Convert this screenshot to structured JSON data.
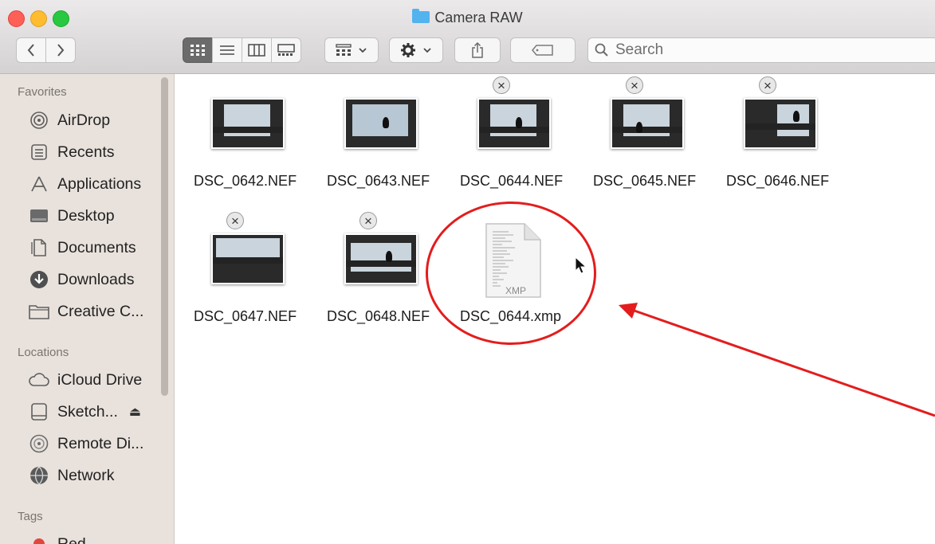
{
  "window": {
    "title": "Camera RAW"
  },
  "toolbar": {
    "back_icon": "chevron-left-icon",
    "forward_icon": "chevron-right-icon",
    "view_modes": [
      "icon-view-icon",
      "list-view-icon",
      "column-view-icon",
      "gallery-view-icon"
    ],
    "active_view": "icon-view-icon",
    "search_placeholder": "Search"
  },
  "sidebar": {
    "favorites_header": "Favorites",
    "favorites": [
      {
        "label": "AirDrop",
        "icon": "airdrop-icon"
      },
      {
        "label": "Recents",
        "icon": "recents-icon"
      },
      {
        "label": "Applications",
        "icon": "applications-icon"
      },
      {
        "label": "Desktop",
        "icon": "desktop-icon"
      },
      {
        "label": "Documents",
        "icon": "documents-icon"
      },
      {
        "label": "Downloads",
        "icon": "downloads-icon"
      },
      {
        "label": "Creative C...",
        "icon": "folder-icon"
      }
    ],
    "locations_header": "Locations",
    "locations": [
      {
        "label": "iCloud Drive",
        "icon": "cloud-icon"
      },
      {
        "label": "Sketch...",
        "icon": "drive-icon",
        "eject": "⏏"
      },
      {
        "label": "Remote Di...",
        "icon": "disc-icon"
      },
      {
        "label": "Network",
        "icon": "network-icon"
      }
    ],
    "tags_header": "Tags",
    "tags": [
      {
        "label": "Red",
        "color": "#e2463c"
      }
    ]
  },
  "files": [
    {
      "name": "DSC_0642.NEF",
      "type": "image",
      "badge": false
    },
    {
      "name": "DSC_0643.NEF",
      "type": "image",
      "badge": false
    },
    {
      "name": "DSC_0644.NEF",
      "type": "image",
      "badge": true
    },
    {
      "name": "DSC_0645.NEF",
      "type": "image",
      "badge": true
    },
    {
      "name": "DSC_0646.NEF",
      "type": "image",
      "badge": true
    },
    {
      "name": "DSC_0647.NEF",
      "type": "image",
      "badge": true
    },
    {
      "name": "DSC_0648.NEF",
      "type": "image",
      "badge": true
    },
    {
      "name": "DSC_0644.xmp",
      "type": "document",
      "badge": false,
      "doc_label": "XMP"
    }
  ],
  "annotation": {
    "color": "#e31d1d"
  }
}
